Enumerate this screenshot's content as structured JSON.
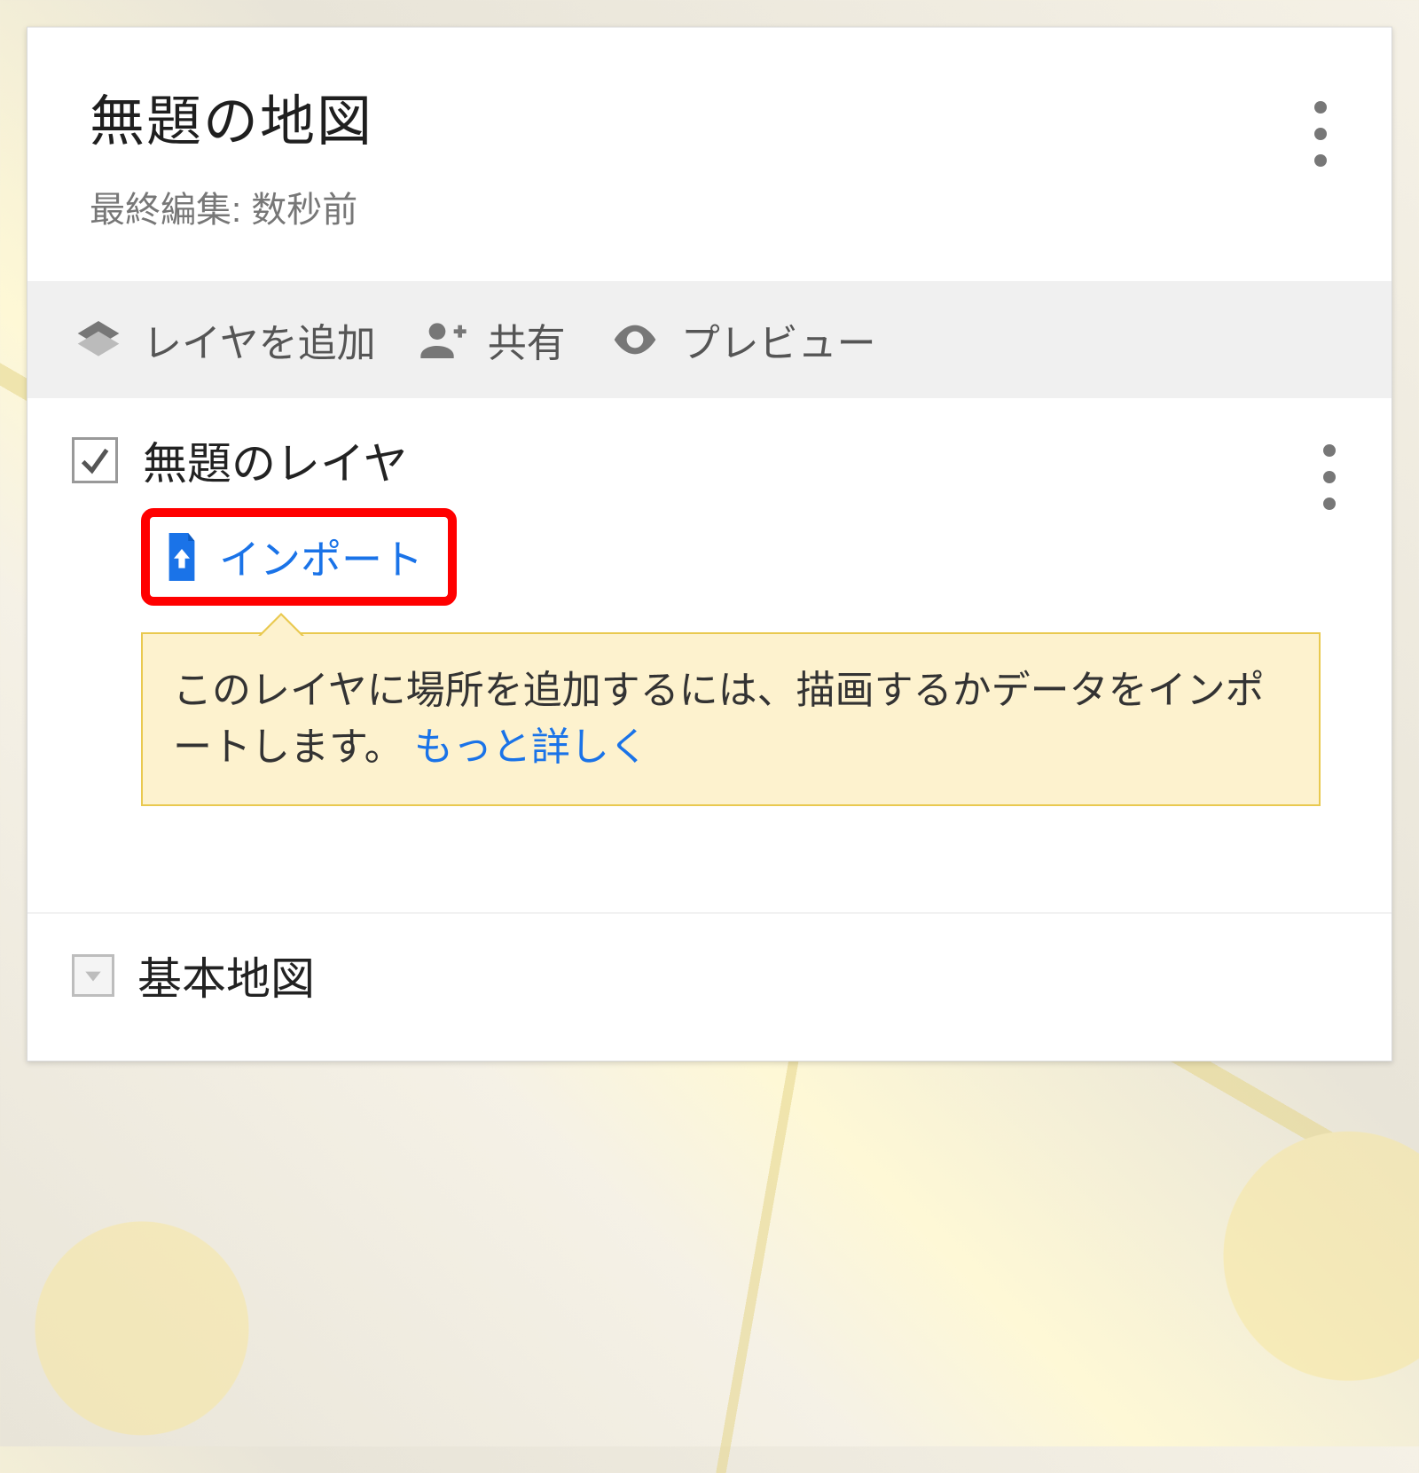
{
  "header": {
    "title": "無題の地図",
    "last_edit": "最終編集: 数秒前"
  },
  "actions": {
    "add_layer": "レイヤを追加",
    "share": "共有",
    "preview": "プレビュー"
  },
  "layer": {
    "name": "無題のレイヤ",
    "import_label": "インポート",
    "tip_text": "このレイヤに場所を追加するには、描画するかデータをインポートします。",
    "tip_more": "もっと詳しく"
  },
  "base_map": {
    "label": "基本地図"
  },
  "colors": {
    "link": "#1a73e8",
    "highlight_border": "#ff0000",
    "tip_bg": "#fdf2ce",
    "tip_border": "#e9c94f"
  }
}
